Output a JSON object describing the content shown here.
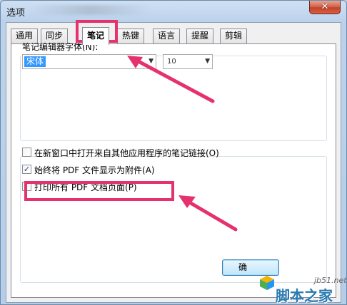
{
  "window": {
    "title": "选项",
    "close_glyph": "✕"
  },
  "tabs": [
    {
      "label": "通用",
      "active": false
    },
    {
      "label": "同步",
      "active": false
    },
    {
      "label": "笔记",
      "active": true
    },
    {
      "label": "热键",
      "active": false
    },
    {
      "label": "语言",
      "active": false
    },
    {
      "label": "提醒",
      "active": false
    },
    {
      "label": "剪辑",
      "active": false
    }
  ],
  "editor_font": {
    "label": "笔记编辑器字体(N):",
    "font_value": "宋体",
    "size_value": "10",
    "arrow_glyph": "▼"
  },
  "options": [
    {
      "label": "在新窗口中打开来自其他应用程序的笔记链接(O)",
      "checked": false
    },
    {
      "label": "始终将 PDF 文件显示为附件(A)",
      "checked": true
    },
    {
      "label": "打印所有 PDF 文档页面(P)",
      "checked": false
    }
  ],
  "check_glyph": "✓",
  "ok_button": {
    "label": "确"
  },
  "watermark": {
    "site": "jb51.net",
    "name": "脚本之家",
    "cube_icon": "cube-logo-icon"
  },
  "colors": {
    "highlight": "#e5326e",
    "selection": "#3399ff"
  }
}
